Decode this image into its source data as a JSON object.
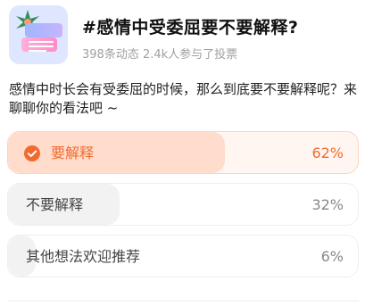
{
  "poll": {
    "title": "#感情中受委屈要不要解释?",
    "meta": "398条动态 2.4k人参与了投票",
    "description": "感情中时长会有受委屈的时候，那么到底要不要解释呢？来聊聊你的看法吧 ~",
    "options": [
      {
        "label": "要解释",
        "percent": "62%",
        "fill": 0.62,
        "selected": true
      },
      {
        "label": "不要解释",
        "percent": "32%",
        "fill": 0.32,
        "selected": false
      },
      {
        "label": "其他想法欢迎推荐",
        "percent": "6%",
        "fill": 0.06,
        "selected": false
      }
    ]
  },
  "colors": {
    "accent": "#f26a2e",
    "selected_fill": "#ffdccb",
    "bar_fill": "#f2f2f2"
  },
  "icons": {
    "thumbnail": "chat-bubbles-icon",
    "selected": "check-circle-icon"
  }
}
